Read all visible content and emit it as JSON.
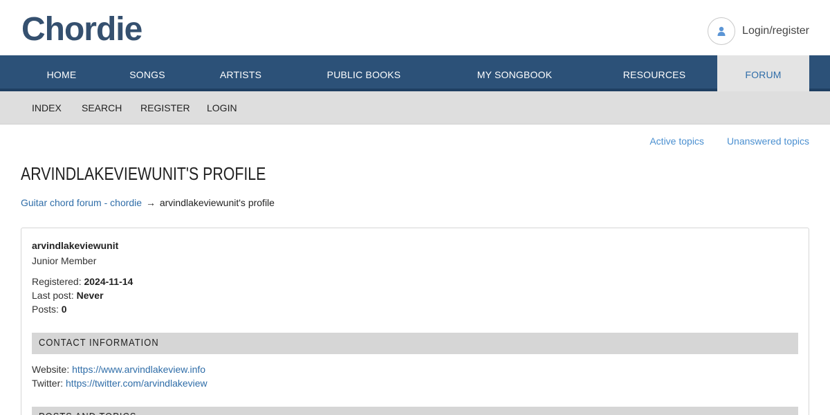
{
  "brand": {
    "logo_text": "Chordie"
  },
  "header": {
    "user_label": "Login/register"
  },
  "main_nav": {
    "items": [
      {
        "label": "HOME",
        "active": false
      },
      {
        "label": "SONGS",
        "active": false
      },
      {
        "label": "ARTISTS",
        "active": false
      },
      {
        "label": "PUBLIC BOOKS",
        "active": false
      },
      {
        "label": "MY SONGBOOK",
        "active": false
      },
      {
        "label": "RESOURCES",
        "active": false
      },
      {
        "label": "FORUM",
        "active": true
      }
    ]
  },
  "sub_nav": {
    "items": [
      {
        "label": "INDEX"
      },
      {
        "label": "SEARCH"
      },
      {
        "label": "REGISTER"
      },
      {
        "label": "LOGIN"
      }
    ]
  },
  "top_links": {
    "active_topics": "Active topics",
    "unanswered_topics": "Unanswered topics"
  },
  "page": {
    "title": "ARVINDLAKEVIEWUNIT'S PROFILE",
    "breadcrumb_link": "Guitar chord forum - chordie",
    "breadcrumb_arrow": "→",
    "breadcrumb_current": "arvindlakeviewunit's profile"
  },
  "profile": {
    "username": "arvindlakeviewunit",
    "rank": "Junior Member",
    "registered_label": "Registered:",
    "registered_value": "2024-11-14",
    "last_post_label": "Last post:",
    "last_post_value": "Never",
    "posts_label": "Posts:",
    "posts_value": "0"
  },
  "contact": {
    "heading": "CONTACT INFORMATION",
    "website_label": "Website:",
    "website_value": "https://www.arvindlakeview.info",
    "twitter_label": "Twitter:",
    "twitter_value": "https://twitter.com/arvindlakeview"
  },
  "posts_section": {
    "heading": "POSTS AND TOPICS"
  },
  "colors": {
    "nav_bg": "#2c5178",
    "nav_active_bg": "#e4e4e4",
    "nav_active_text": "#2f6da8",
    "subnav_bg": "#dedede",
    "link": "#2f6da8",
    "top_link": "#4a8fd0",
    "logo": "#35506f"
  },
  "icons": {
    "user": "user-icon"
  }
}
